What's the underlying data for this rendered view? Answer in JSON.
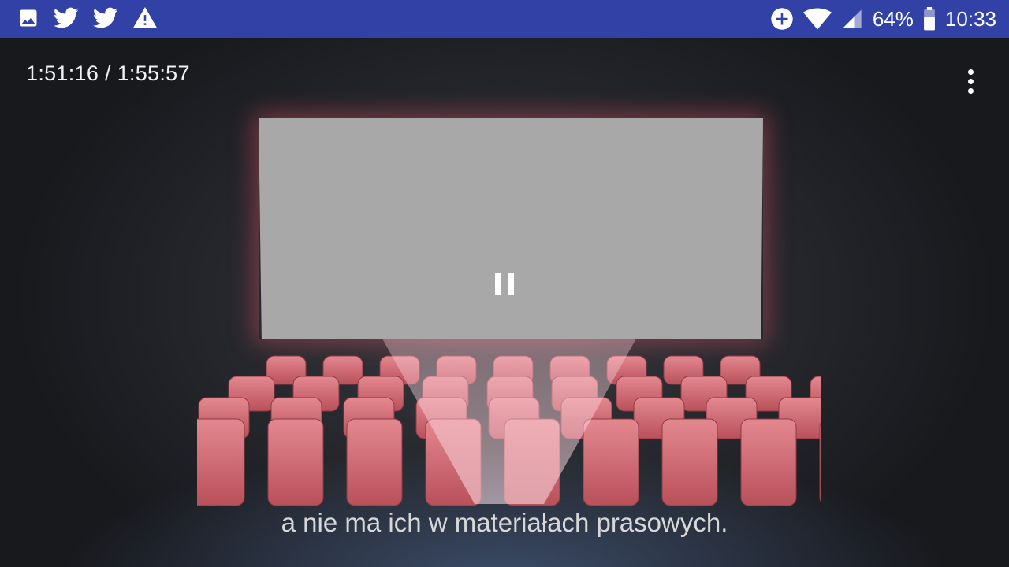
{
  "status_bar": {
    "left_icons": [
      "image-icon",
      "twitter-icon",
      "twitter-icon",
      "warning-icon"
    ],
    "right_icons": [
      "data-saver-icon",
      "wifi-icon",
      "cell-signal-icon",
      "battery-icon"
    ],
    "battery_percent": "64%",
    "time": "10:33"
  },
  "player": {
    "elapsed": "1:51:16 / 1:55:57",
    "state": "paused",
    "subtitle": "a nie ma ich w materiałach prasowych."
  },
  "colors": {
    "status_bar_bg": "#3241a5",
    "screen": "#a8a8a8",
    "seat": "#d46a72"
  }
}
